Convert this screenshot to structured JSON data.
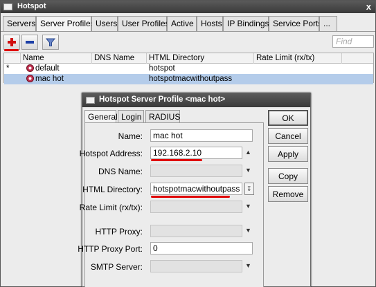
{
  "window": {
    "title": "Hotspot",
    "close": "x"
  },
  "tabs": [
    "Servers",
    "Server Profiles",
    "Users",
    "User Profiles",
    "Active",
    "Hosts",
    "IP Bindings",
    "Service Ports",
    "..."
  ],
  "toolbar": {
    "find_placeholder": "Find"
  },
  "grid": {
    "headers": [
      "Name",
      "DNS Name",
      "HTML Directory",
      "Rate Limit (rx/tx)"
    ],
    "rows": [
      {
        "marker": "*",
        "name": "default",
        "dns": "",
        "html": "hotspot",
        "rate": ""
      },
      {
        "marker": "",
        "name": "mac hot",
        "dns": "",
        "html": "hotspotmacwithoutpass",
        "rate": ""
      }
    ]
  },
  "dialog": {
    "title": "Hotspot Server Profile <mac hot>",
    "tabs": [
      "General",
      "Login",
      "RADIUS"
    ],
    "fields": {
      "name": {
        "label": "Name:",
        "value": "mac hot"
      },
      "hotspot_address": {
        "label": "Hotspot Address:",
        "value": "192.168.2.10"
      },
      "dns_name": {
        "label": "DNS Name:",
        "value": ""
      },
      "html_directory": {
        "label": "HTML Directory:",
        "value": "hotspotmacwithoutpass"
      },
      "rate_limit": {
        "label": "Rate Limit (rx/tx):",
        "value": ""
      },
      "http_proxy": {
        "label": "HTTP Proxy:",
        "value": ""
      },
      "http_proxy_port": {
        "label": "HTTP Proxy Port:",
        "value": "0"
      },
      "smtp_server": {
        "label": "SMTP Server:",
        "value": ""
      }
    },
    "buttons": {
      "ok": "OK",
      "cancel": "Cancel",
      "apply": "Apply",
      "copy": "Copy",
      "remove": "Remove"
    }
  },
  "colors": {
    "highlight": "#e00000",
    "selection": "#b4ccea",
    "titlebar": "#444444"
  }
}
